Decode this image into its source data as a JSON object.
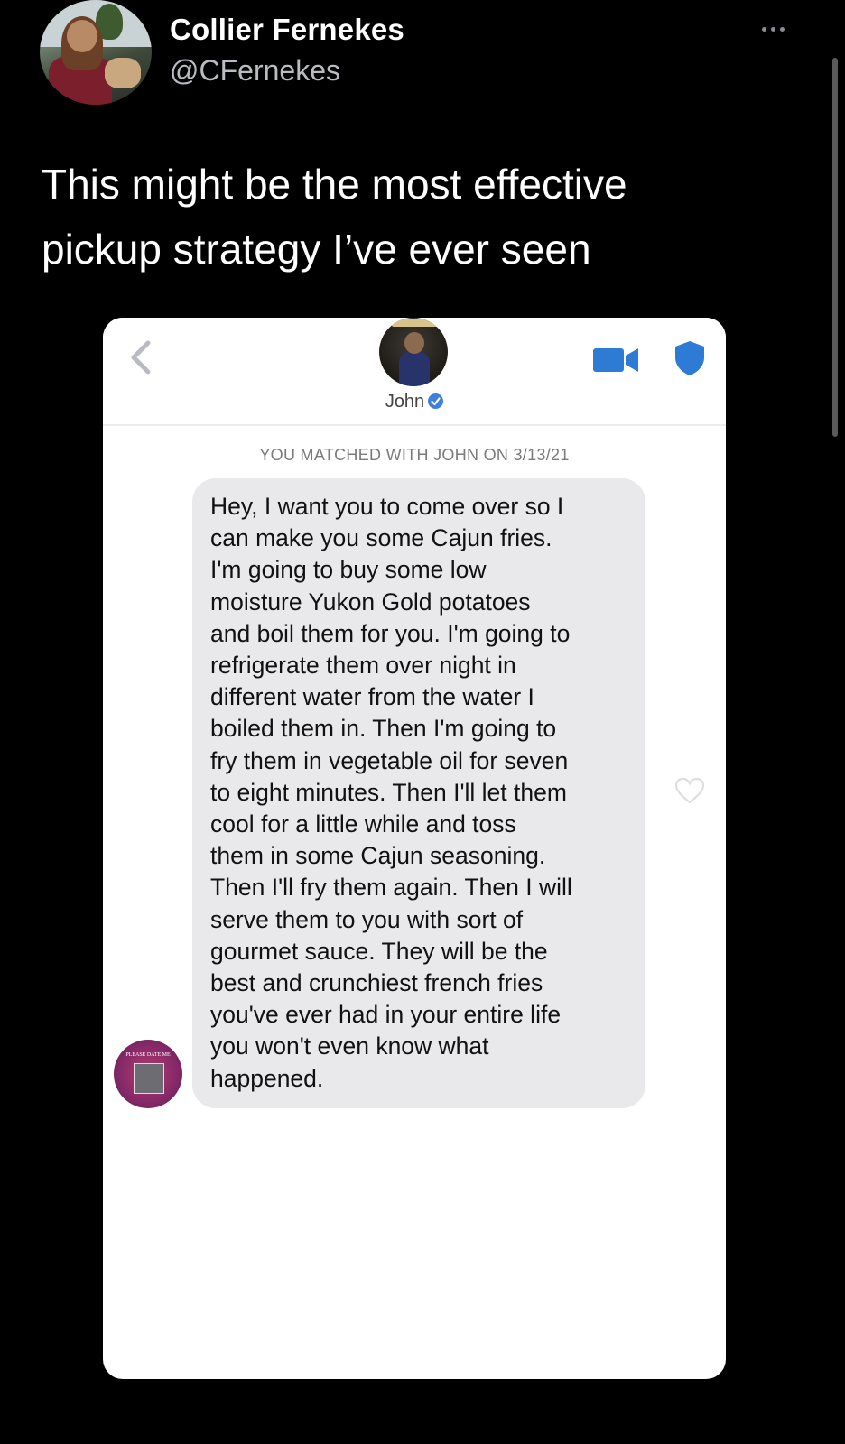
{
  "tweet": {
    "display_name": "Collier Fernekes",
    "handle": "@CFernekes",
    "text": "This might be the most effective pickup strategy I’ve ever seen",
    "avatar_icon": "profile-photo",
    "more_icon": "ellipsis-icon"
  },
  "chat": {
    "contact_name": "John",
    "verified_icon": "verified-check-icon",
    "match_text": "YOU MATCHED WITH JOHN ON 3/13/21",
    "message": "Hey, I want you to come over so I\ncan make you some Cajun fries.\nI'm going to buy some low\nmoisture Yukon Gold potatoes\nand boil them for you. I'm going to\nrefrigerate them over night in\ndifferent water from the water I\nboiled them in. Then I'm going to\nfry them in vegetable oil for seven\nto eight minutes. Then I'll let them\ncool for a little while and toss\nthem in some Cajun seasoning.\nThen I'll fry them again. Then I will\nserve them to you with sort of\ngourmet sauce. They will be the\nbest and crunchiest french fries\nyou've ever had in your entire life\nyou won't even know what\nhappened.",
    "sender_avatar_caption": "PLEASE DATE ME",
    "accent_color": "#3f7fe0",
    "bubble_color": "#e9e9eb",
    "icons": {
      "back": "chevron-left-icon",
      "video": "video-call-icon",
      "shield": "shield-icon",
      "heart": "heart-outline-icon"
    }
  }
}
